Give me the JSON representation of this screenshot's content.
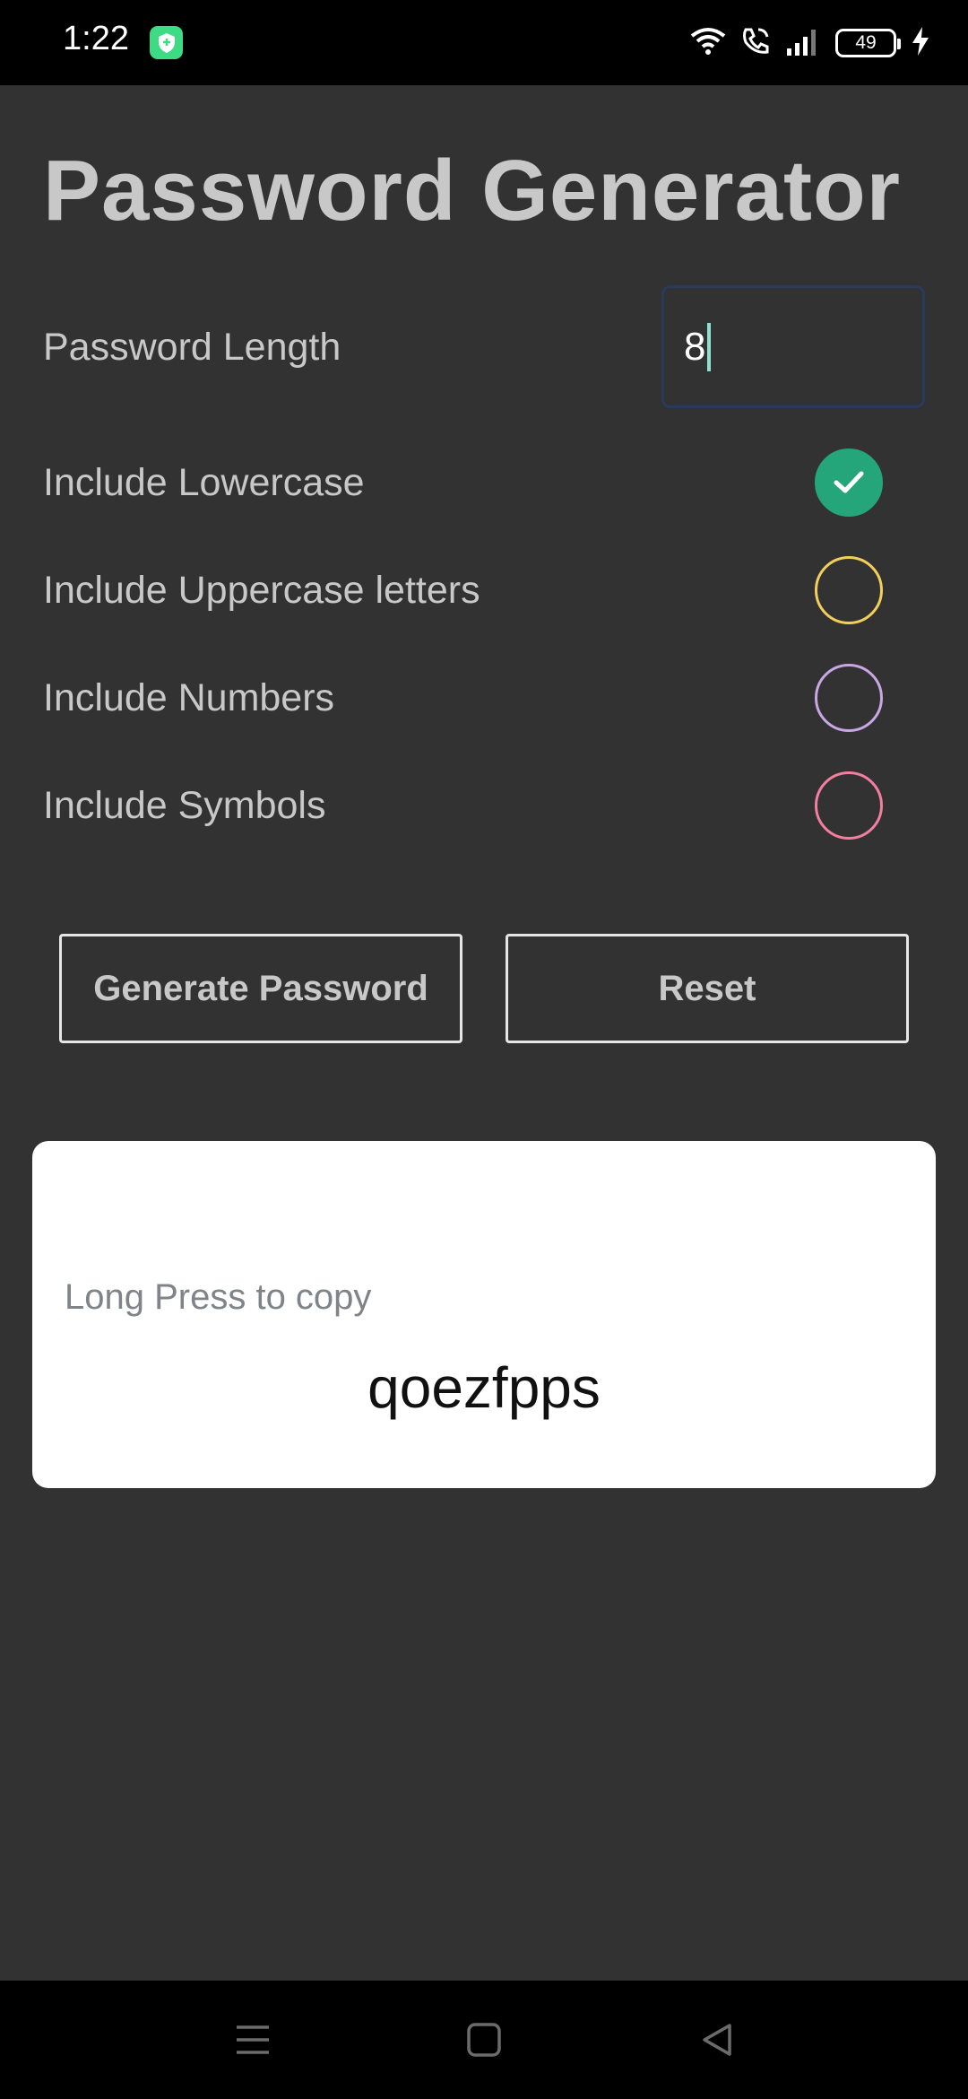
{
  "status_bar": {
    "time": "1:22",
    "battery_level": "49",
    "icons": [
      "shield-app-icon",
      "wifi-icon",
      "wifi-calling-icon",
      "signal-icon",
      "battery-icon",
      "charging-icon"
    ]
  },
  "app": {
    "title": "Password Generator",
    "length_label": "Password Length",
    "length_value": "8",
    "options": [
      {
        "label": "Include Lowercase",
        "checked": true,
        "color": "#24a67a"
      },
      {
        "label": "Include Uppercase letters",
        "checked": false,
        "color": "#f2cf5b"
      },
      {
        "label": "Include Numbers",
        "checked": false,
        "color": "#c9a6e4"
      },
      {
        "label": "Include Symbols",
        "checked": false,
        "color": "#f27fa0"
      }
    ],
    "generate_label": "Generate Password",
    "reset_label": "Reset",
    "copy_hint": "Long Press to copy",
    "password": "qoezfpps"
  },
  "nav_bar": {
    "icons": [
      "recents-menu-icon",
      "home-square-icon",
      "back-triangle-icon"
    ]
  }
}
